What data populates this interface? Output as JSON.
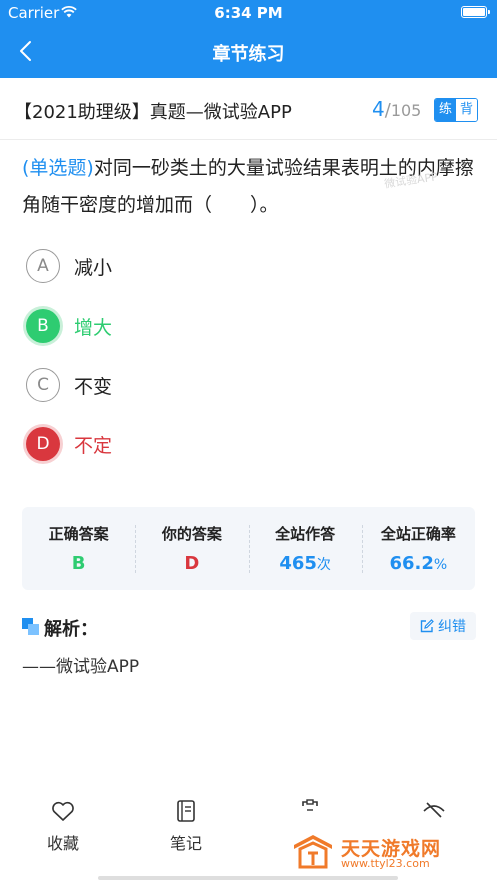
{
  "status_bar": {
    "carrier": "Carrier",
    "time": "6:34 PM"
  },
  "nav": {
    "title": "章节练习"
  },
  "question_header": {
    "title": "【2021助理级】真题—微试验APP",
    "current": "4",
    "separator": "/",
    "total": "105",
    "mode_practice": "练",
    "mode_recite": "背"
  },
  "question": {
    "type_label": "(单选题)",
    "text": "对同一砂类土的大量试验结果表明土的内摩擦角随干密度的增加而（　　）。",
    "watermark": "微试验APP",
    "options": [
      {
        "letter": "A",
        "text": "减小",
        "state": "normal"
      },
      {
        "letter": "B",
        "text": "增大",
        "state": "correct"
      },
      {
        "letter": "C",
        "text": "不变",
        "state": "normal"
      },
      {
        "letter": "D",
        "text": "不定",
        "state": "wrong"
      }
    ]
  },
  "stats": {
    "correct_answer_label": "正确答案",
    "correct_answer": "B",
    "your_answer_label": "你的答案",
    "your_answer": "D",
    "attempts_label": "全站作答",
    "attempts": "465",
    "attempts_unit": "次",
    "accuracy_label": "全站正确率",
    "accuracy": "66.2",
    "accuracy_unit": "%"
  },
  "analysis": {
    "title": "解析：",
    "report_label": "纠错",
    "content": "——微试验APP"
  },
  "tabbar": {
    "items": [
      {
        "label": "收藏",
        "icon": "heart-icon"
      },
      {
        "label": "笔记",
        "icon": "notebook-icon"
      },
      {
        "label": "",
        "icon": "card-icon"
      },
      {
        "label": "",
        "icon": "eye-slash-icon"
      }
    ]
  },
  "site_watermark": {
    "name": "天天游戏网",
    "url": "www.ttyl23.com"
  },
  "colors": {
    "primary": "#1f8ff0",
    "correct": "#2ecc71",
    "wrong": "#d9373e",
    "watermark": "#f07a2a"
  }
}
